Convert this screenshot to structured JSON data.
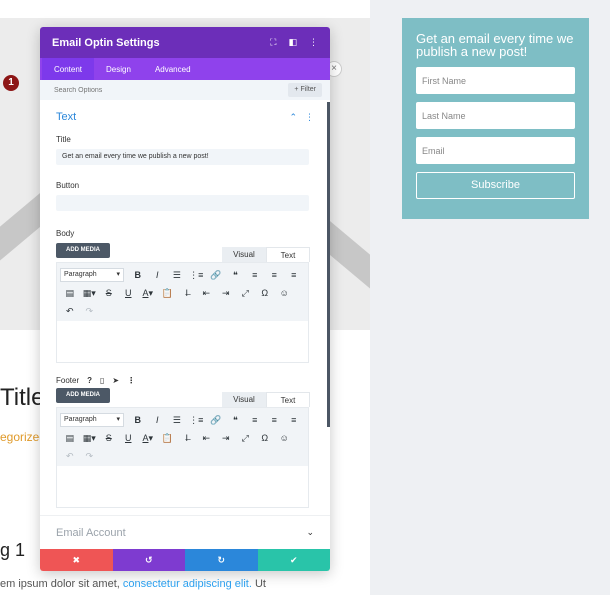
{
  "background": {
    "title": "Title",
    "category": "egorized",
    "heading": "g 1",
    "paragraph_text": "em ipsum dolor sit amet, ",
    "paragraph_link": "consectetur adipiscing elit.",
    "paragraph_tail": " Ut"
  },
  "optin": {
    "title": "Get an email every time we publish a new post!",
    "first_name_placeholder": "First Name",
    "last_name_placeholder": "Last Name",
    "email_placeholder": "Email",
    "subscribe_label": "Subscribe"
  },
  "modal": {
    "title": "Email Optin Settings",
    "tabs": [
      {
        "label": "Content",
        "active": true
      },
      {
        "label": "Design"
      },
      {
        "label": "Advanced"
      }
    ],
    "search_placeholder": "Search Options",
    "filter_label": "+ Filter",
    "text_section": {
      "title": "Text",
      "title_field_label": "Title",
      "title_value": "Get an email every time we publish a new post!",
      "badge": "1",
      "button_field_label": "Button",
      "button_value": "",
      "body_label": "Body",
      "footer_label": "Footer"
    },
    "editor": {
      "add_media": "ADD MEDIA",
      "visual_tab": "Visual",
      "text_tab": "Text",
      "format_select": "Paragraph"
    },
    "email_account_label": "Email Account"
  },
  "colors": {
    "header": "#6c2eb9",
    "tabs": "#8f42ec",
    "optin_card": "#7ebec5",
    "cancel": "#ef5555",
    "undo": "#7e3bd0",
    "redo": "#2b87da",
    "save": "#29c4a9"
  }
}
